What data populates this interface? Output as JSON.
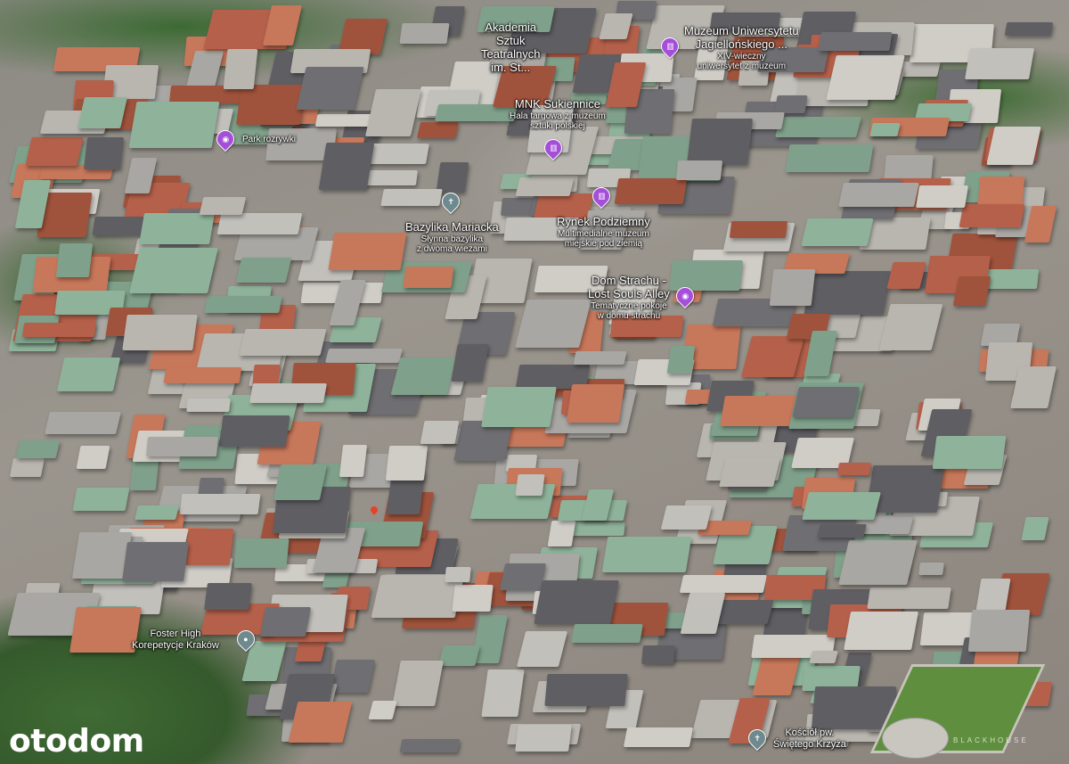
{
  "places": [
    {
      "title": "Akademia Sztuk Teatralnych im. St...",
      "lines": [
        "Akademia",
        "Sztuk",
        "Teatralnych",
        "im. St..."
      ],
      "subtitle": "",
      "pin": "none"
    },
    {
      "title": "Muzeum Uniwersytetu Jagiellońskiego ...",
      "lines": [
        "Muzeum Uniwersytetu",
        "Jagiellońskiego ..."
      ],
      "subtitle": "XIV-wieczny uniwersytet z muzeum",
      "sub_lines": [
        "XIV-wieczny",
        "uniwersytet z muzeum"
      ],
      "pin": "museum-icon"
    },
    {
      "title": "Park rozrywki",
      "pin": "camera-icon"
    },
    {
      "title": "MNK Sukiennice",
      "sub_lines": [
        "Hala targowa z muzeum",
        "sztuki polskiej"
      ],
      "pin": "museum-icon"
    },
    {
      "title": "Bazylika Mariacka",
      "sub_lines": [
        "Słynna bazylika",
        "z dwoma wieżami"
      ],
      "pin": "church-icon"
    },
    {
      "title": "Rynek Podziemny",
      "sub_lines": [
        "Multimedialne muzeum",
        "miejskie pod ziemią"
      ],
      "pin": "museum-icon"
    },
    {
      "lines": [
        "Dom Strachu -",
        "Lost Souls Alley"
      ],
      "sub_lines": [
        "Tematyczne pokoje",
        "w domu strachu"
      ],
      "pin": "camera-icon"
    },
    {
      "lines": [
        "Foster High",
        "Korepetycje Kraków"
      ],
      "pin": "place-icon"
    },
    {
      "lines": [
        "Kościół pw.",
        "Świętego Krzyża"
      ],
      "pin": "church-icon"
    }
  ],
  "logo": "otodom",
  "watermark": "BLACKHOUSE",
  "colors": {
    "poi_purple": "#a54fd9",
    "poi_gray": "#6f8a8f",
    "selected_pin": "#e8412a"
  }
}
